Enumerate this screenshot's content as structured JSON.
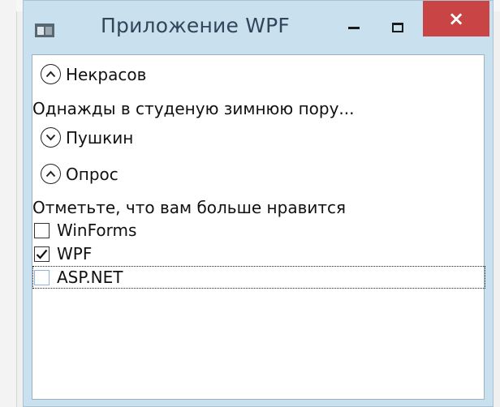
{
  "window": {
    "title": "Приложение WPF",
    "close_glyph": "×"
  },
  "content": {
    "expander1": {
      "header": "Некрасов",
      "expanded": true,
      "body": "Однажды в студеную зимнюю пору..."
    },
    "expander2": {
      "header": "Пушкин",
      "expanded": false
    },
    "expander3": {
      "header": "Опрос",
      "expanded": true,
      "prompt": "Отметьте, что вам больше нравится"
    },
    "checkboxes": [
      {
        "label": "WinForms",
        "checked": false
      },
      {
        "label": "WPF",
        "checked": true
      },
      {
        "label": "ASP.NET",
        "checked": false,
        "focused": true
      }
    ]
  },
  "colors": {
    "titlebar": "#c9e0ef",
    "close_button": "#c94545",
    "title_text": "#33455a"
  },
  "icons": [
    "app-window-icon",
    "minimize-icon",
    "maximize-icon",
    "close-icon",
    "chevron-up-icon",
    "chevron-down-icon",
    "check-icon"
  ]
}
